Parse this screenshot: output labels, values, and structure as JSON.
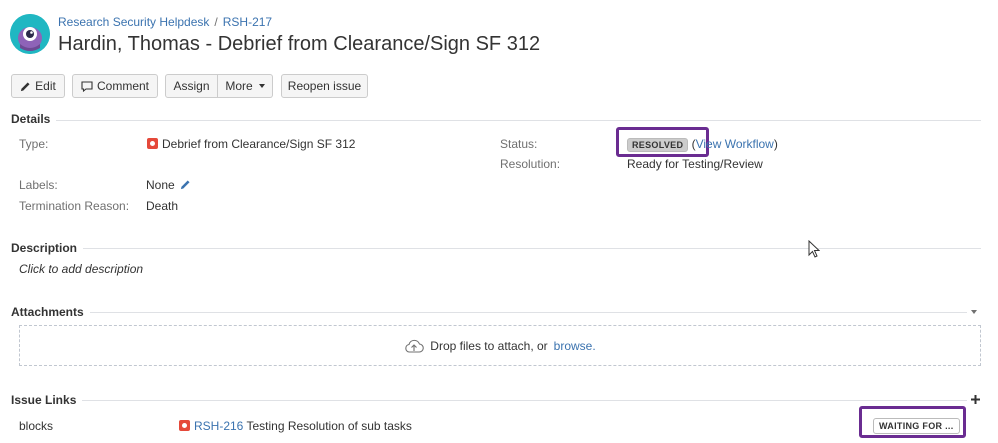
{
  "breadcrumb": {
    "project": "Research Security Helpdesk",
    "separator": "/",
    "issue_key": "RSH-217"
  },
  "issue": {
    "title": "Hardin, Thomas - Debrief from Clearance/Sign SF 312"
  },
  "toolbar": {
    "edit_label": "Edit",
    "comment_label": "Comment",
    "assign_label": "Assign",
    "more_label": "More",
    "reopen_label": "Reopen issue"
  },
  "details": {
    "heading": "Details",
    "type_label": "Type:",
    "type_value": "Debrief from Clearance/Sign SF 312",
    "labels_label": "Labels:",
    "labels_value": "None",
    "termination_label": "Termination Reason:",
    "termination_value": "Death",
    "status_label": "Status:",
    "status_value": "RESOLVED",
    "view_workflow_open": "(",
    "view_workflow": "View Workflow",
    "view_workflow_close": ")",
    "resolution_label": "Resolution:",
    "resolution_value": "Ready for Testing/Review"
  },
  "description": {
    "heading": "Description",
    "placeholder": "Click to add description"
  },
  "attachments": {
    "heading": "Attachments",
    "drop_text": "Drop files to attach, or",
    "browse": "browse."
  },
  "issue_links": {
    "heading": "Issue Links",
    "relation": "blocks",
    "linked_key": "RSH-216",
    "linked_summary": "Testing Resolution of sub tasks",
    "linked_status": "WAITING FOR ..."
  },
  "colors": {
    "link": "#3b73af",
    "highlight": "#6a2c91",
    "type_icon": "#e5493a",
    "avatar": "#20b7c2"
  }
}
